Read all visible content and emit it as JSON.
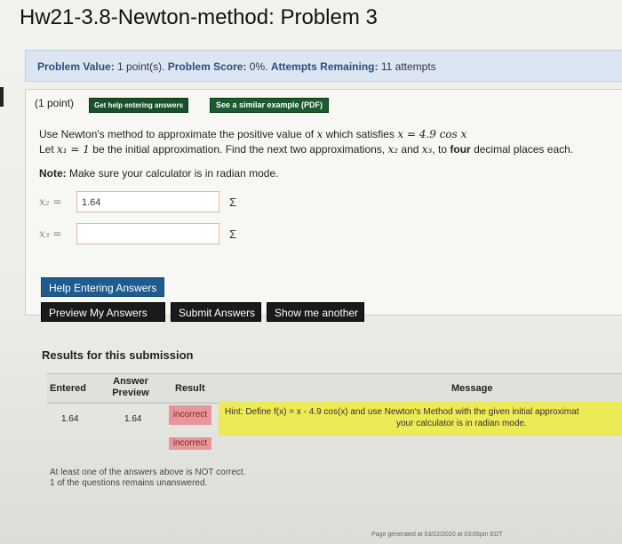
{
  "header": {
    "title": "Hw21-3.8-Newton-method: Problem 3"
  },
  "info": {
    "value_label": "Problem Value:",
    "value": "1 point(s).",
    "score_label": "Problem Score:",
    "score": "0%.",
    "attempts_label": "Attempts Remaining:",
    "attempts": "11 attempts"
  },
  "problem": {
    "points": "(1 point)",
    "help_btn": "Get help entering answers",
    "similar_btn": "See a similar example (PDF)",
    "line1_text": "Use Newton's method to approximate the positive value of",
    "line1_var": "x",
    "line1_mid": "which satisfies",
    "line1_eq": "x = 4.9 cos x",
    "line2_pre": "Let",
    "line2_var": "x₁ = 1",
    "line2_mid": "be the initial approximation. Find the next two approximations,",
    "line2_x2": "x₂",
    "line2_and": "and",
    "line2_x3": "x₃",
    "line2_end_a": ", to",
    "line2_bold": "four",
    "line2_end_b": "decimal places each.",
    "note_label": "Note:",
    "note_text": "Make sure your calculator is in radian mode."
  },
  "answers": [
    {
      "label": "x₂ =",
      "value": "1.64",
      "sigma": "Σ"
    },
    {
      "label": "x₃ =",
      "value": "",
      "sigma": "Σ"
    }
  ],
  "buttons": {
    "help": "Help Entering Answers",
    "preview": "Preview My Answers",
    "submit": "Submit Answers",
    "another": "Show me another"
  },
  "results": {
    "heading": "Results for this submission",
    "headers": {
      "entered": "Entered",
      "preview": "Answer Preview",
      "result": "Result",
      "message": "Message"
    },
    "row1": {
      "entered": "1.64",
      "preview": "1.64",
      "result": "incorrect"
    },
    "row2": {
      "result": "incorrect"
    },
    "message1": "Hint: Define f(x) = x - 4.9 cos(x) and use Newton's Method with the given initial approximat",
    "message2": "your calculator is in radian mode.",
    "summary1": "At least one of the answers above is NOT correct.",
    "summary2": "1 of the questions remains unanswered."
  },
  "footer": {
    "generated": "Page generated at 03/22/2020 at 03:05pm EDT"
  }
}
